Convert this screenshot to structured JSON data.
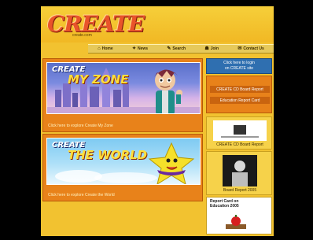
{
  "header": {
    "logo": "CREATE",
    "logo_sub": "create.com"
  },
  "nav": {
    "items": [
      {
        "icon": "⌂",
        "label": "Home"
      },
      {
        "icon": "✦",
        "label": "News"
      },
      {
        "icon": "✎",
        "label": "Search"
      },
      {
        "icon": "☗",
        "label": "Join"
      },
      {
        "icon": "✉",
        "label": "Contact Us"
      }
    ]
  },
  "main": {
    "zone": {
      "title_line1": "CREATE",
      "title_line2": "MY ZONE",
      "caption": "Click here to explore Create My Zone"
    },
    "world": {
      "title_line1": "CREATE",
      "title_line2": "THE WORLD",
      "caption": "Click here to explore Create the World"
    }
  },
  "sidebar": {
    "login": {
      "line1": "Click here to login",
      "line2": "on CREATE site"
    },
    "links": [
      "CREATE CD Board Report",
      "Education Report Card"
    ],
    "promos": [
      {
        "caption": "CREATE CD Board Report"
      },
      {
        "caption": "Board Report 2005"
      },
      {
        "caption": "Report Card on Education 2005"
      }
    ]
  },
  "colors": {
    "background": "#000000",
    "site": "#f2c230",
    "panel": "#e8821a",
    "logo": "#e9542a",
    "login_box": "#2f6fb0"
  }
}
